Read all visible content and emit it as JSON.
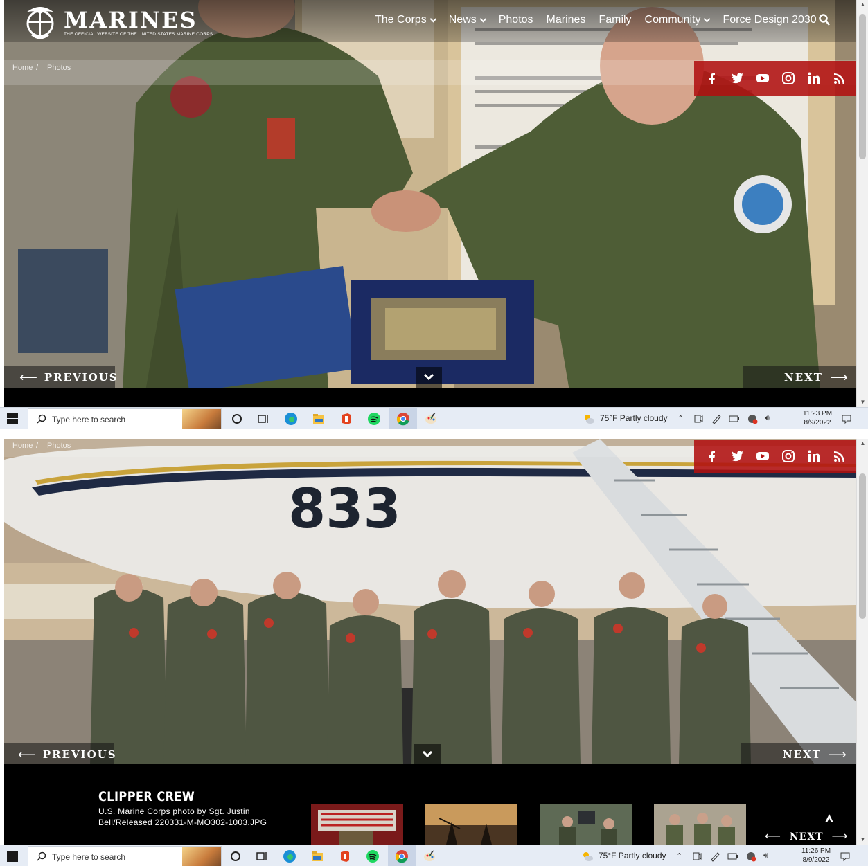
{
  "site": {
    "logo_word": "MARINES",
    "logo_tagline": "THE OFFICIAL WEBSITE OF THE UNITED STATES MARINE CORPS",
    "nav": [
      {
        "label": "The Corps",
        "dropdown": true
      },
      {
        "label": "News",
        "dropdown": true
      },
      {
        "label": "Photos",
        "dropdown": false
      },
      {
        "label": "Marines",
        "dropdown": false
      },
      {
        "label": "Family",
        "dropdown": false
      },
      {
        "label": "Community",
        "dropdown": true
      },
      {
        "label": "Force Design 2030",
        "dropdown": false
      }
    ],
    "breadcrumb": [
      "Home",
      "Photos"
    ],
    "social_icons": [
      "facebook-icon",
      "twitter-icon",
      "youtube-icon",
      "instagram-icon",
      "linkedin-icon",
      "rss-icon"
    ],
    "accent_color": "#b01010"
  },
  "pager": {
    "previous": "PREVIOUS",
    "next": "NEXT"
  },
  "photo_info": {
    "title": "CLIPPER CREW",
    "credit": "U.S. Marine Corps photo by Sgt. Justin Bell/Released 220331-M-MO302-1003.JPG",
    "next_label": "NEXT"
  },
  "taskbar": {
    "search_placeholder": "Type here to search",
    "weather": "75°F  Partly cloudy",
    "shot1_time": "11:23 PM",
    "shot1_date": "8/9/2022",
    "shot2_time": "11:26 PM",
    "shot2_date": "8/9/2022"
  }
}
